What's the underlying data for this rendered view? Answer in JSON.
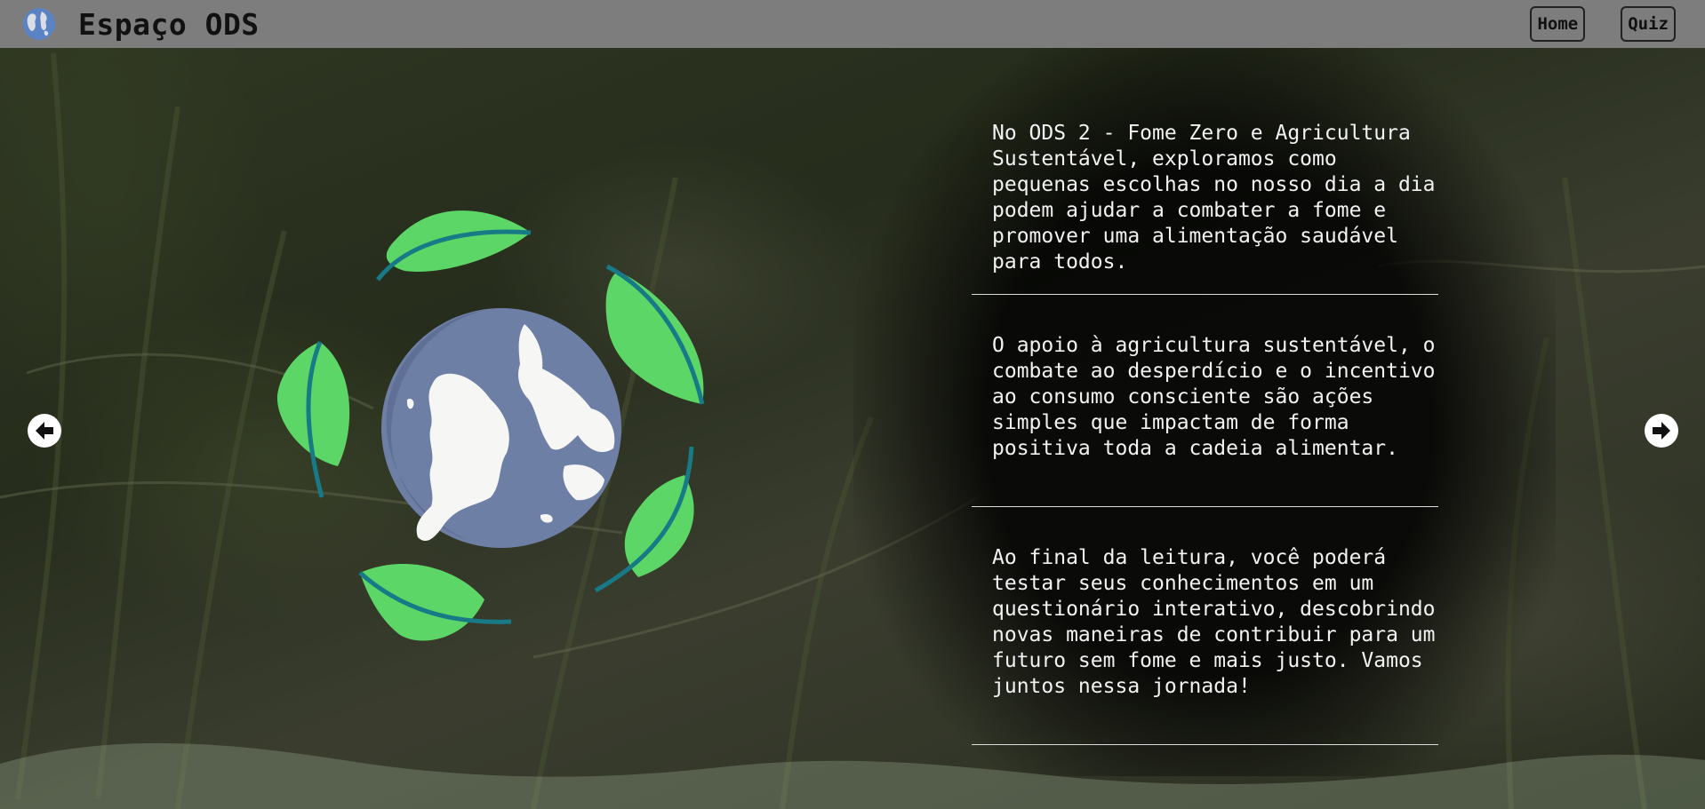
{
  "header": {
    "logo_icon": "globe-icon",
    "title": "Espaço ODS",
    "nav": {
      "home_label": "Home",
      "quiz_label": "Quiz"
    }
  },
  "content": {
    "paragraphs": [
      "No ODS 2 - Fome Zero e Agricultura Sustentável, exploramos como pequenas escolhas no nosso dia a dia podem ajudar a combater a fome e promover uma alimentação saudável para todos.",
      "O apoio à agricultura sustentável, o combate ao desperdício e o incentivo ao consumo consciente são ações simples que impactam de forma positiva toda a cadeia alimentar.",
      "Ao final da leitura, você poderá testar seus conhecimentos em um questionário interativo, descobrindo novas maneiras de contribuir para um futuro sem fome e mais justo. Vamos juntos nessa jornada!"
    ]
  },
  "controls": {
    "prev_icon": "arrow-left-icon",
    "next_icon": "arrow-right-icon"
  },
  "illustration": {
    "icon": "globe-with-leaves-icon"
  },
  "colors": {
    "header_bg": "#7d7d7d",
    "leaf_green": "#5cd666",
    "leaf_vein": "#177a86",
    "globe_ocean": "#6e7fa6",
    "globe_land": "#f6f7f4"
  }
}
